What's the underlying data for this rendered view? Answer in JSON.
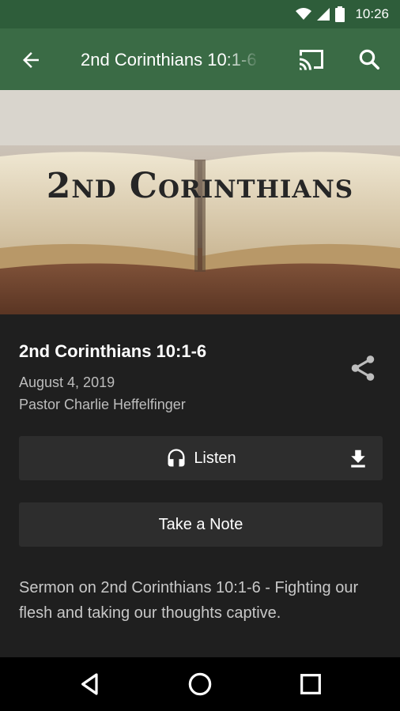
{
  "status_bar": {
    "time": "10:26"
  },
  "app_bar": {
    "title": "2nd Corinthians 10:1-6"
  },
  "hero": {
    "text": "2nd Corinthians"
  },
  "sermon": {
    "title": "2nd Corinthians 10:1-6",
    "date": "August 4, 2019",
    "speaker": "Pastor Charlie Heffelfinger",
    "description": "Sermon on 2nd Corinthians 10:1-6 - Fighting our flesh and taking our thoughts captive."
  },
  "actions": {
    "listen_label": "Listen",
    "note_label": "Take a Note"
  },
  "icons": [
    "wifi-icon",
    "signal-icon",
    "battery-icon",
    "back-arrow-icon",
    "cast-icon",
    "search-icon",
    "share-icon",
    "headphones-icon",
    "download-icon",
    "nav-back-icon",
    "nav-home-icon",
    "nav-recents-icon"
  ],
  "colors": {
    "status_bar": "#2e5d3a",
    "app_bar": "#3a6b45",
    "background": "#1f1f1f",
    "button": "#2d2d2d"
  }
}
